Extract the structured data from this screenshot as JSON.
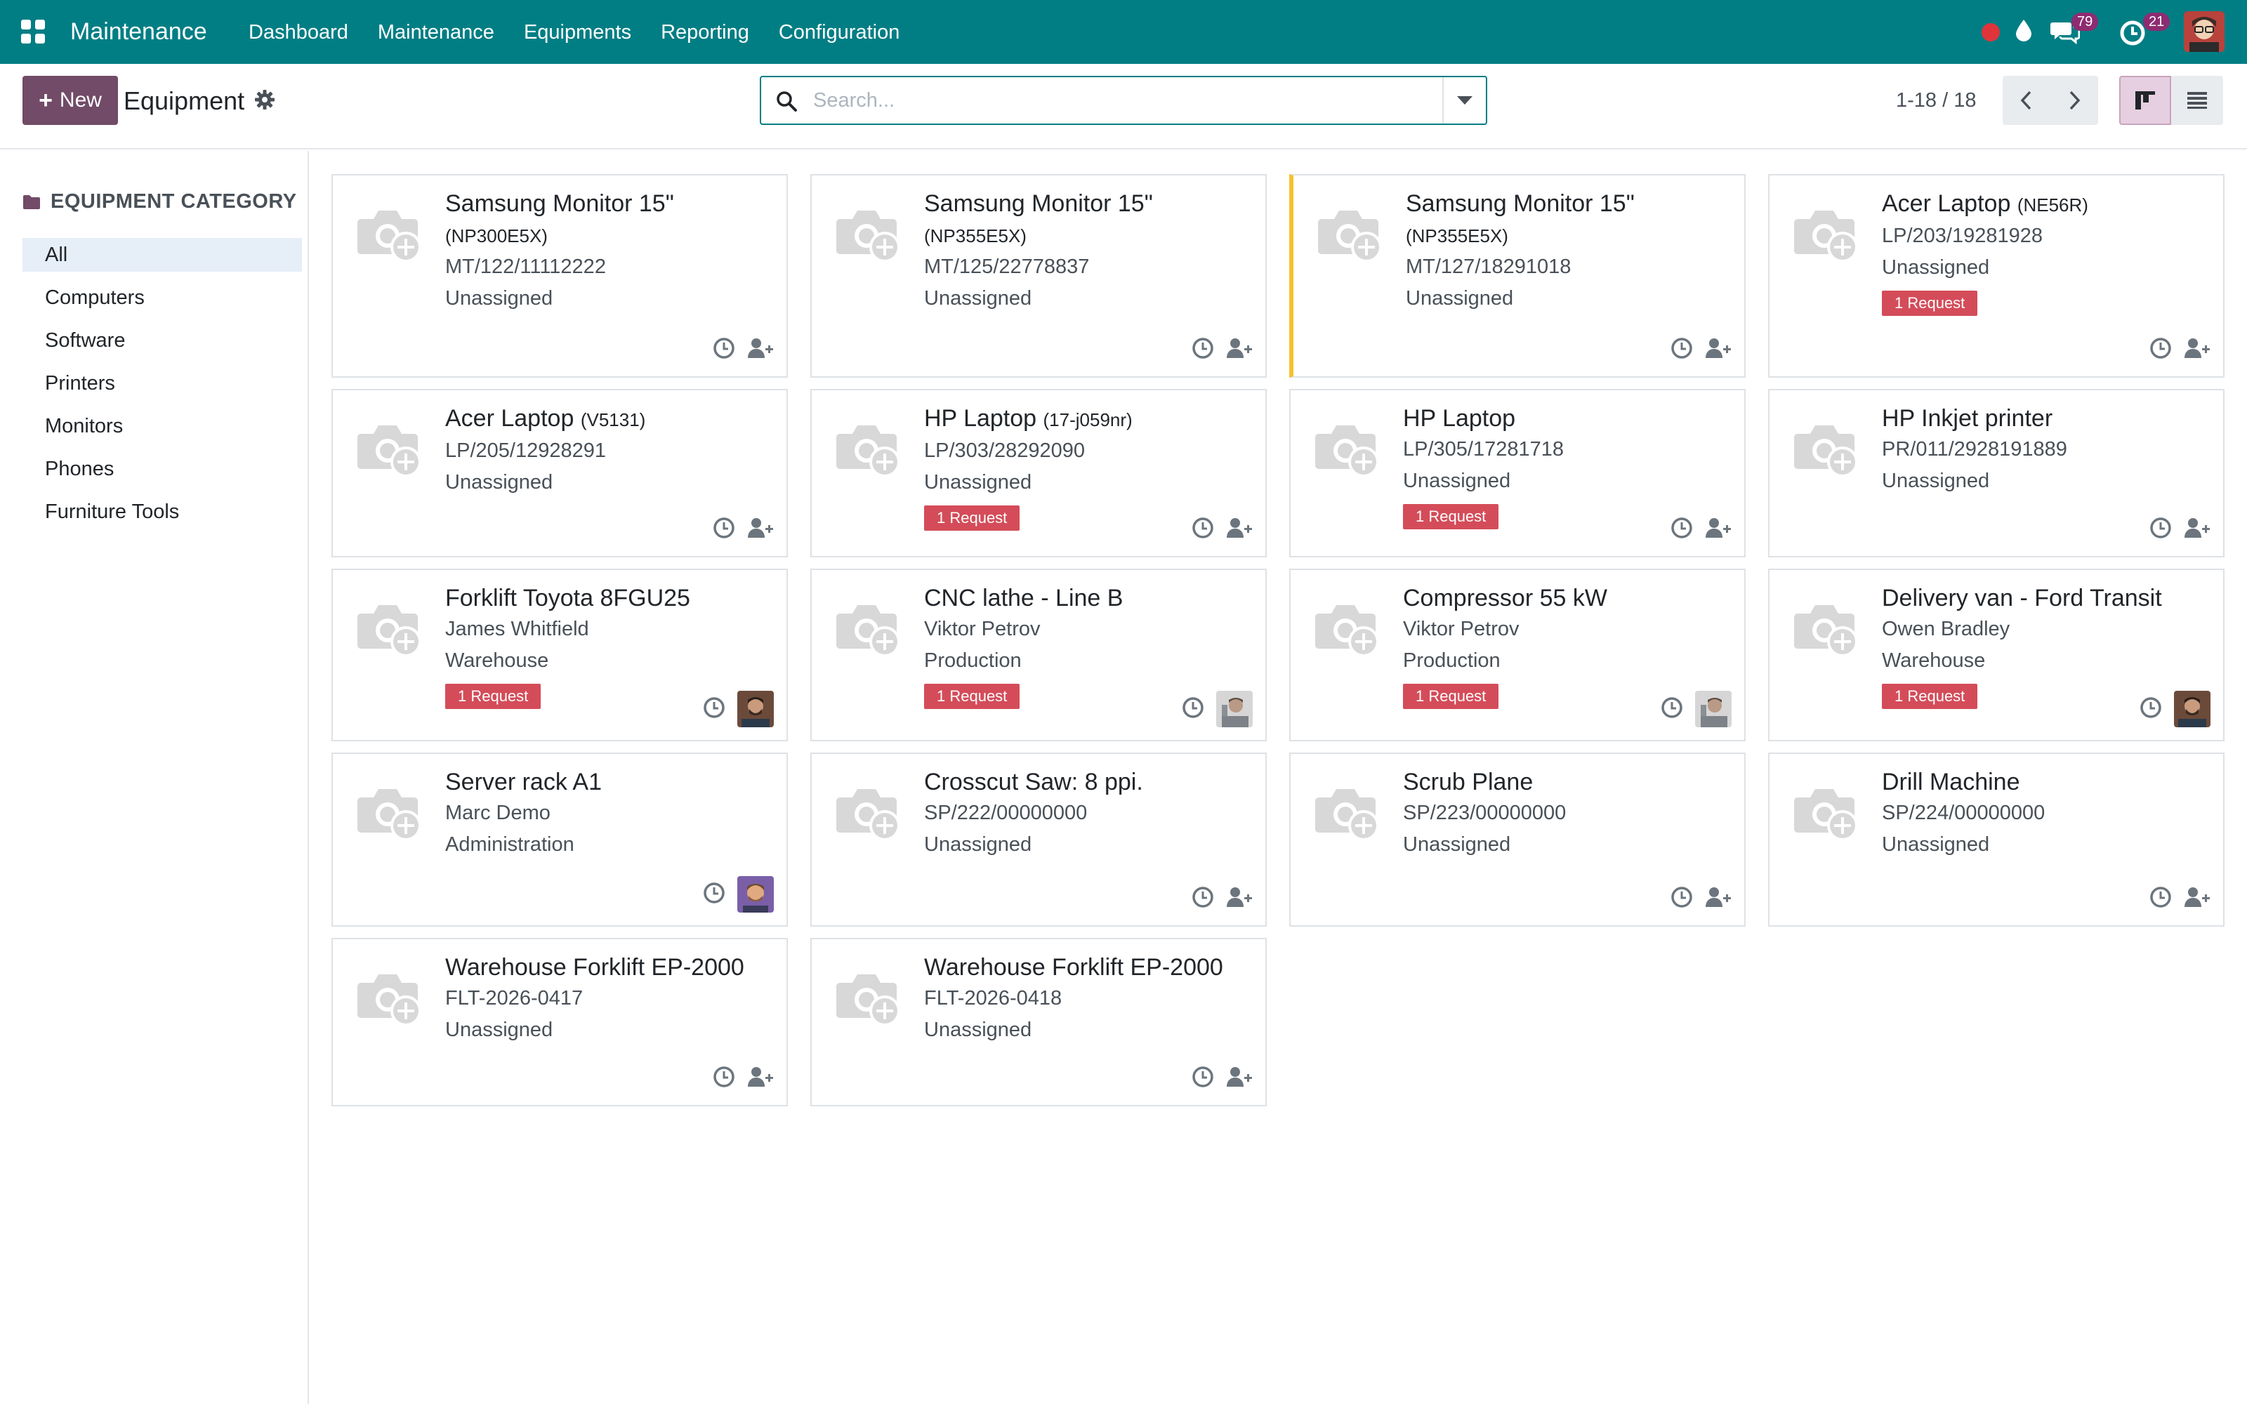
{
  "navbar": {
    "brand": "Maintenance",
    "menu": [
      "Dashboard",
      "Maintenance",
      "Equipments",
      "Reporting",
      "Configuration"
    ],
    "messages_count": "79",
    "activities_count": "21"
  },
  "control_panel": {
    "new_label": "New",
    "title": "Equipment",
    "search_placeholder": "Search...",
    "pager": "1-18 / 18"
  },
  "sidebar": {
    "header": "EQUIPMENT CATEGORY",
    "items": [
      "All",
      "Computers",
      "Software",
      "Printers",
      "Monitors",
      "Phones",
      "Furniture Tools"
    ],
    "active": "All"
  },
  "cards": [
    {
      "name": "Samsung Monitor 15\"",
      "model": "(NP300E5X)",
      "model_newline": true,
      "line1": "MT/122/11112222",
      "line2": "Unassigned",
      "request": "",
      "assignee": "none"
    },
    {
      "name": "Samsung Monitor 15\"",
      "model": "(NP355E5X)",
      "model_newline": true,
      "line1": "MT/125/22778837",
      "line2": "Unassigned",
      "request": "",
      "assignee": "none"
    },
    {
      "name": "Samsung Monitor 15\"",
      "model": "(NP355E5X)",
      "model_newline": true,
      "line1": "MT/127/18291018",
      "line2": "Unassigned",
      "request": "",
      "assignee": "none",
      "highlight": true
    },
    {
      "name": "Acer Laptop",
      "model": "(NE56R)",
      "line1": "LP/203/19281928",
      "line2": "Unassigned",
      "request": "1 Request",
      "assignee": "none"
    },
    {
      "name": "Acer Laptop",
      "model": "(V5131)",
      "line1": "LP/205/12928291",
      "line2": "Unassigned",
      "request": "",
      "assignee": "none"
    },
    {
      "name": "HP Laptop",
      "model": "(17-j059nr)",
      "line1": "LP/303/28292090",
      "line2": "Unassigned",
      "request": "1 Request",
      "assignee": "none"
    },
    {
      "name": "HP Laptop",
      "model": "",
      "line1": "LP/305/17281718",
      "line2": "Unassigned",
      "request": "1 Request",
      "assignee": "none"
    },
    {
      "name": "HP Inkjet printer",
      "model": "",
      "line1": "PR/011/2928191889",
      "line2": "Unassigned",
      "request": "",
      "assignee": "none"
    },
    {
      "name": "Forklift Toyota 8FGU25",
      "model": "",
      "line1": "James Whitfield",
      "line2": "Warehouse",
      "request": "1 Request",
      "assignee": "avatar-dark"
    },
    {
      "name": "CNC lathe - Line B",
      "model": "",
      "line1": "Viktor Petrov",
      "line2": "Production",
      "request": "1 Request",
      "assignee": "avatar-grey"
    },
    {
      "name": "Compressor 55 kW",
      "model": "",
      "line1": "Viktor Petrov",
      "line2": "Production",
      "request": "1 Request",
      "assignee": "avatar-grey"
    },
    {
      "name": "Delivery van - Ford Transit",
      "model": "",
      "line1": "Owen Bradley",
      "line2": "Warehouse",
      "request": "1 Request",
      "assignee": "avatar-dark"
    },
    {
      "name": "Server rack A1",
      "model": "",
      "line1": "Marc Demo",
      "line2": "Administration",
      "request": "",
      "assignee": "avatar-purple"
    },
    {
      "name": "Crosscut Saw: 8 ppi.",
      "model": "",
      "line1": "SP/222/00000000",
      "line2": "Unassigned",
      "request": "",
      "assignee": "none"
    },
    {
      "name": "Scrub Plane",
      "model": "",
      "line1": "SP/223/00000000",
      "line2": "Unassigned",
      "request": "",
      "assignee": "none"
    },
    {
      "name": "Drill Machine",
      "model": "",
      "line1": "SP/224/00000000",
      "line2": "Unassigned",
      "request": "",
      "assignee": "none"
    },
    {
      "name": "Warehouse Forklift EP-2000",
      "model": "",
      "line1": "FLT-2026-0417",
      "line2": "Unassigned",
      "request": "",
      "assignee": "none"
    },
    {
      "name": "Warehouse Forklift EP-2000",
      "model": "",
      "line1": "FLT-2026-0418",
      "line2": "Unassigned",
      "request": "",
      "assignee": "none"
    }
  ]
}
